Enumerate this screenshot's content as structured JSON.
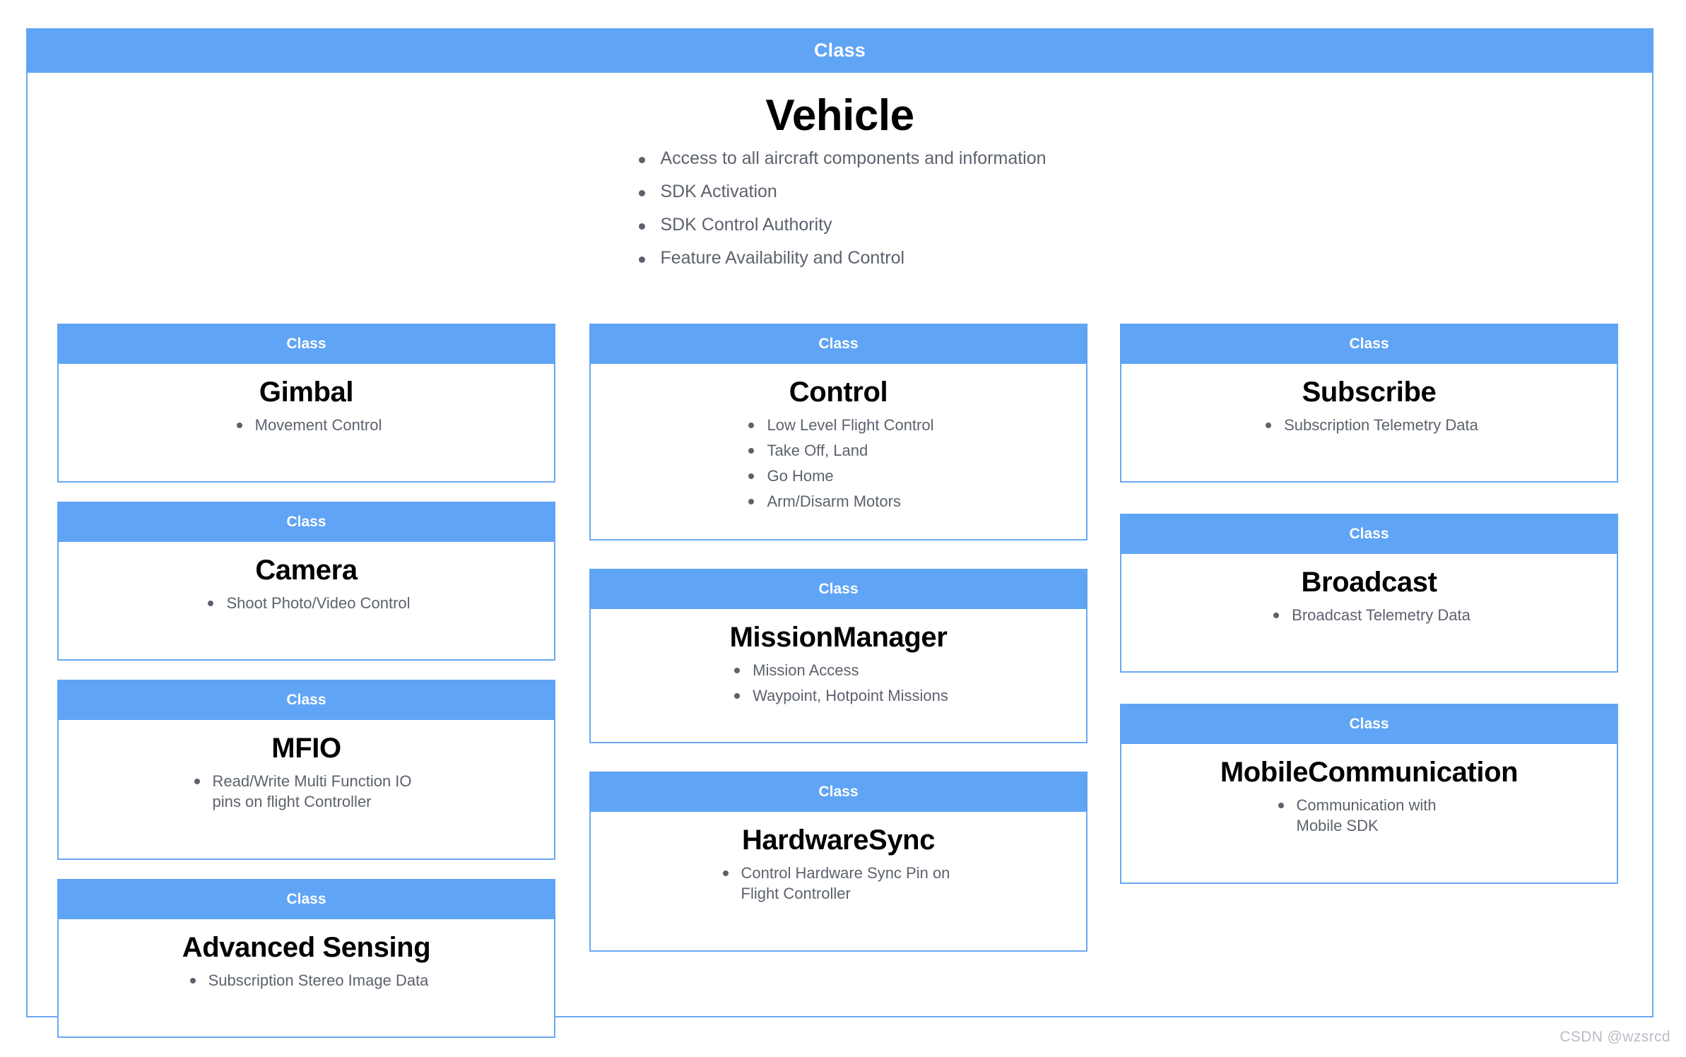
{
  "root": {
    "header_label": "Class",
    "title": "Vehicle",
    "bullets": [
      "Access to all aircraft components and information",
      "SDK Activation",
      "SDK Control Authority",
      "Feature Availability and Control"
    ]
  },
  "colors": {
    "accent_blue": "#60a4f5",
    "border_blue": "#6aa9f2",
    "bullet_text": "#5c626d",
    "title_text": "#000000",
    "header_text": "#ffffff",
    "watermark_text": "#b9bdc4"
  },
  "columns": {
    "left": [
      {
        "header_label": "Class",
        "title": "Gimbal",
        "bullets": [
          "Movement Control"
        ]
      },
      {
        "header_label": "Class",
        "title": "Camera",
        "bullets": [
          "Shoot Photo/Video Control"
        ]
      },
      {
        "header_label": "Class",
        "title": "MFIO",
        "bullets": [
          "Read/Write Multi Function IO pins on flight Controller"
        ]
      },
      {
        "header_label": "Class",
        "title": "Advanced Sensing",
        "bullets": [
          "Subscription Stereo Image Data"
        ]
      }
    ],
    "mid": [
      {
        "header_label": "Class",
        "title": "Control",
        "bullets": [
          "Low Level Flight Control",
          "Take Off, Land",
          "Go Home",
          "Arm/Disarm Motors"
        ]
      },
      {
        "header_label": "Class",
        "title": "MissionManager",
        "bullets": [
          "Mission Access",
          "Waypoint, Hotpoint Missions"
        ]
      },
      {
        "header_label": "Class",
        "title": "HardwareSync",
        "bullets": [
          "Control Hardware Sync Pin on Flight Controller"
        ]
      }
    ],
    "right": [
      {
        "header_label": "Class",
        "title": "Subscribe",
        "bullets": [
          "Subscription Telemetry Data"
        ]
      },
      {
        "header_label": "Class",
        "title": "Broadcast",
        "bullets": [
          "Broadcast Telemetry Data"
        ]
      },
      {
        "header_label": "Class",
        "title": "MobileCommunication",
        "bullets": [
          "Communication with Mobile SDK"
        ]
      }
    ]
  },
  "watermark": "CSDN @wzsrcd"
}
